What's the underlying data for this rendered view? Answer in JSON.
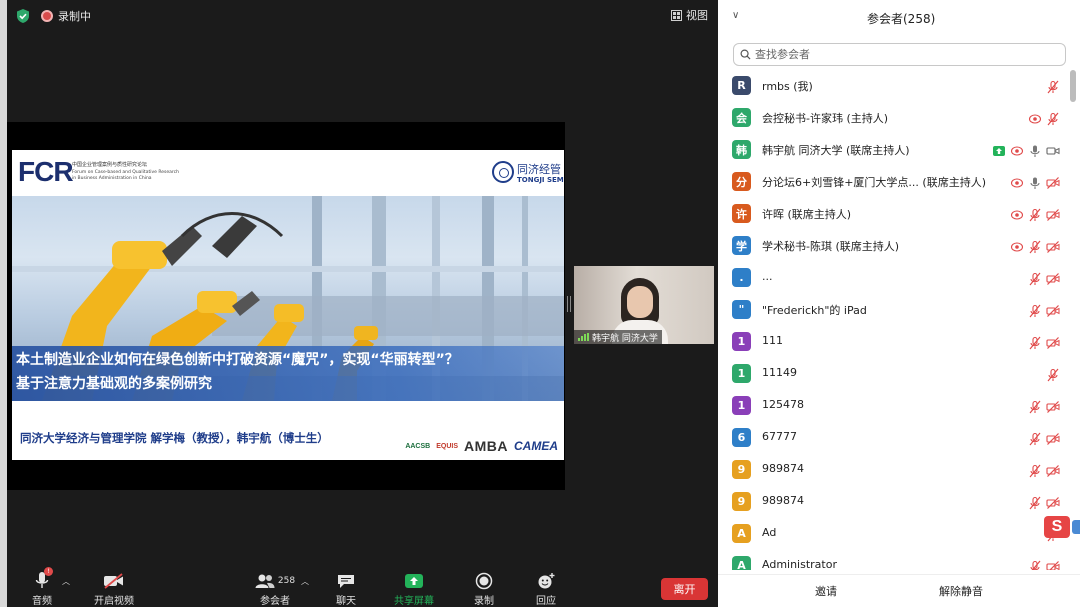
{
  "topbar": {
    "recording_label": "录制中",
    "view_label": "视图"
  },
  "slide": {
    "forum_logo": "FCR",
    "forum_cn": "中国企业管理案例与质性研究论坛",
    "forum_en1": "Forum on Case-based and Qualitative Research",
    "forum_en2": "in Business Administration in China",
    "school_cn": "同济经管",
    "school_en": "TONGJI SEM",
    "title_line1": "本土制造业企业如何在绿色创新中打破资源“魔咒”，实现“华丽转型”？",
    "title_line2": "基于注意力基础观的多案例研究",
    "authors": "同济大学经济与管理学院  解学梅（教授），韩宇航（博士生）",
    "accreditation_logos": [
      "AACSB",
      "EQUIS",
      "AMBA",
      "CAMEA"
    ]
  },
  "video_tile": {
    "name": "韩宇航 同济大学"
  },
  "toolbar": {
    "audio_label": "音频",
    "audio_badge": "!",
    "video_label": "开启视频",
    "participants_label": "参会者",
    "participants_count": "258",
    "chat_label": "聊天",
    "share_label": "共享屏幕",
    "record_label": "录制",
    "reactions_label": "回应",
    "leave_label": "离开"
  },
  "panel": {
    "title": "参会者(258)",
    "search_placeholder": "查找参会者",
    "invite_label": "邀请",
    "mute_all_label": "解除静音",
    "participants": [
      {
        "initial": "R",
        "name": "rmbs (我)",
        "color": "#3a4a6b",
        "icons": [
          "mic-muted"
        ]
      },
      {
        "initial": "会",
        "name": "会控秘书-许家玮 (主持人)",
        "color": "#2ea86b",
        "icons": [
          "record",
          "mic-muted"
        ]
      },
      {
        "initial": "韩",
        "name": "韩宇航 同济大学 (联席主持人)",
        "color": "#2ea86b",
        "icons": [
          "share",
          "record",
          "mic",
          "video"
        ]
      },
      {
        "initial": "分",
        "name": "分论坛6+刘雪锋+厦门大学点...  (联席主持人)",
        "color": "#d85a1e",
        "icons": [
          "record",
          "mic",
          "video-off"
        ]
      },
      {
        "initial": "许",
        "name": "许晖 (联席主持人)",
        "color": "#d85a1e",
        "icons": [
          "record",
          "mic-muted",
          "video-off"
        ]
      },
      {
        "initial": "学",
        "name": "学术秘书-陈琪 (联席主持人)",
        "color": "#2e7fc8",
        "icons": [
          "record",
          "mic-muted",
          "video-off"
        ]
      },
      {
        "initial": ".",
        "name": "...",
        "color": "#2e7fc8",
        "icons": [
          "mic-muted",
          "video-off"
        ]
      },
      {
        "initial": "\"",
        "name": "\"Frederickh\"的 iPad",
        "color": "#2e7fc8",
        "icons": [
          "mic-muted",
          "video-off"
        ]
      },
      {
        "initial": "1",
        "name": "111",
        "color": "#8a3fb8",
        "icons": [
          "mic-muted",
          "video-off"
        ]
      },
      {
        "initial": "1",
        "name": "11149",
        "color": "#2ea86b",
        "icons": [
          "mic-muted"
        ]
      },
      {
        "initial": "1",
        "name": "125478",
        "color": "#8a3fb8",
        "icons": [
          "mic-muted",
          "video-off"
        ]
      },
      {
        "initial": "6",
        "name": "67777",
        "color": "#2e7fc8",
        "icons": [
          "mic-muted",
          "video-off"
        ]
      },
      {
        "initial": "9",
        "name": "989874",
        "color": "#e6a020",
        "icons": [
          "mic-muted",
          "video-off"
        ]
      },
      {
        "initial": "9",
        "name": "989874",
        "color": "#e6a020",
        "icons": [
          "mic-muted",
          "video-off"
        ]
      },
      {
        "initial": "A",
        "name": "Ad",
        "color": "#e6a020",
        "icons": [
          "mic-muted"
        ]
      },
      {
        "initial": "A",
        "name": "Administrator",
        "color": "#2ea86b",
        "icons": [
          "mic-muted",
          "video-off"
        ]
      }
    ]
  },
  "colors": {
    "accent_green": "#2ea86b",
    "leave_red": "#d93535",
    "muted_red": "#e04a4a"
  }
}
